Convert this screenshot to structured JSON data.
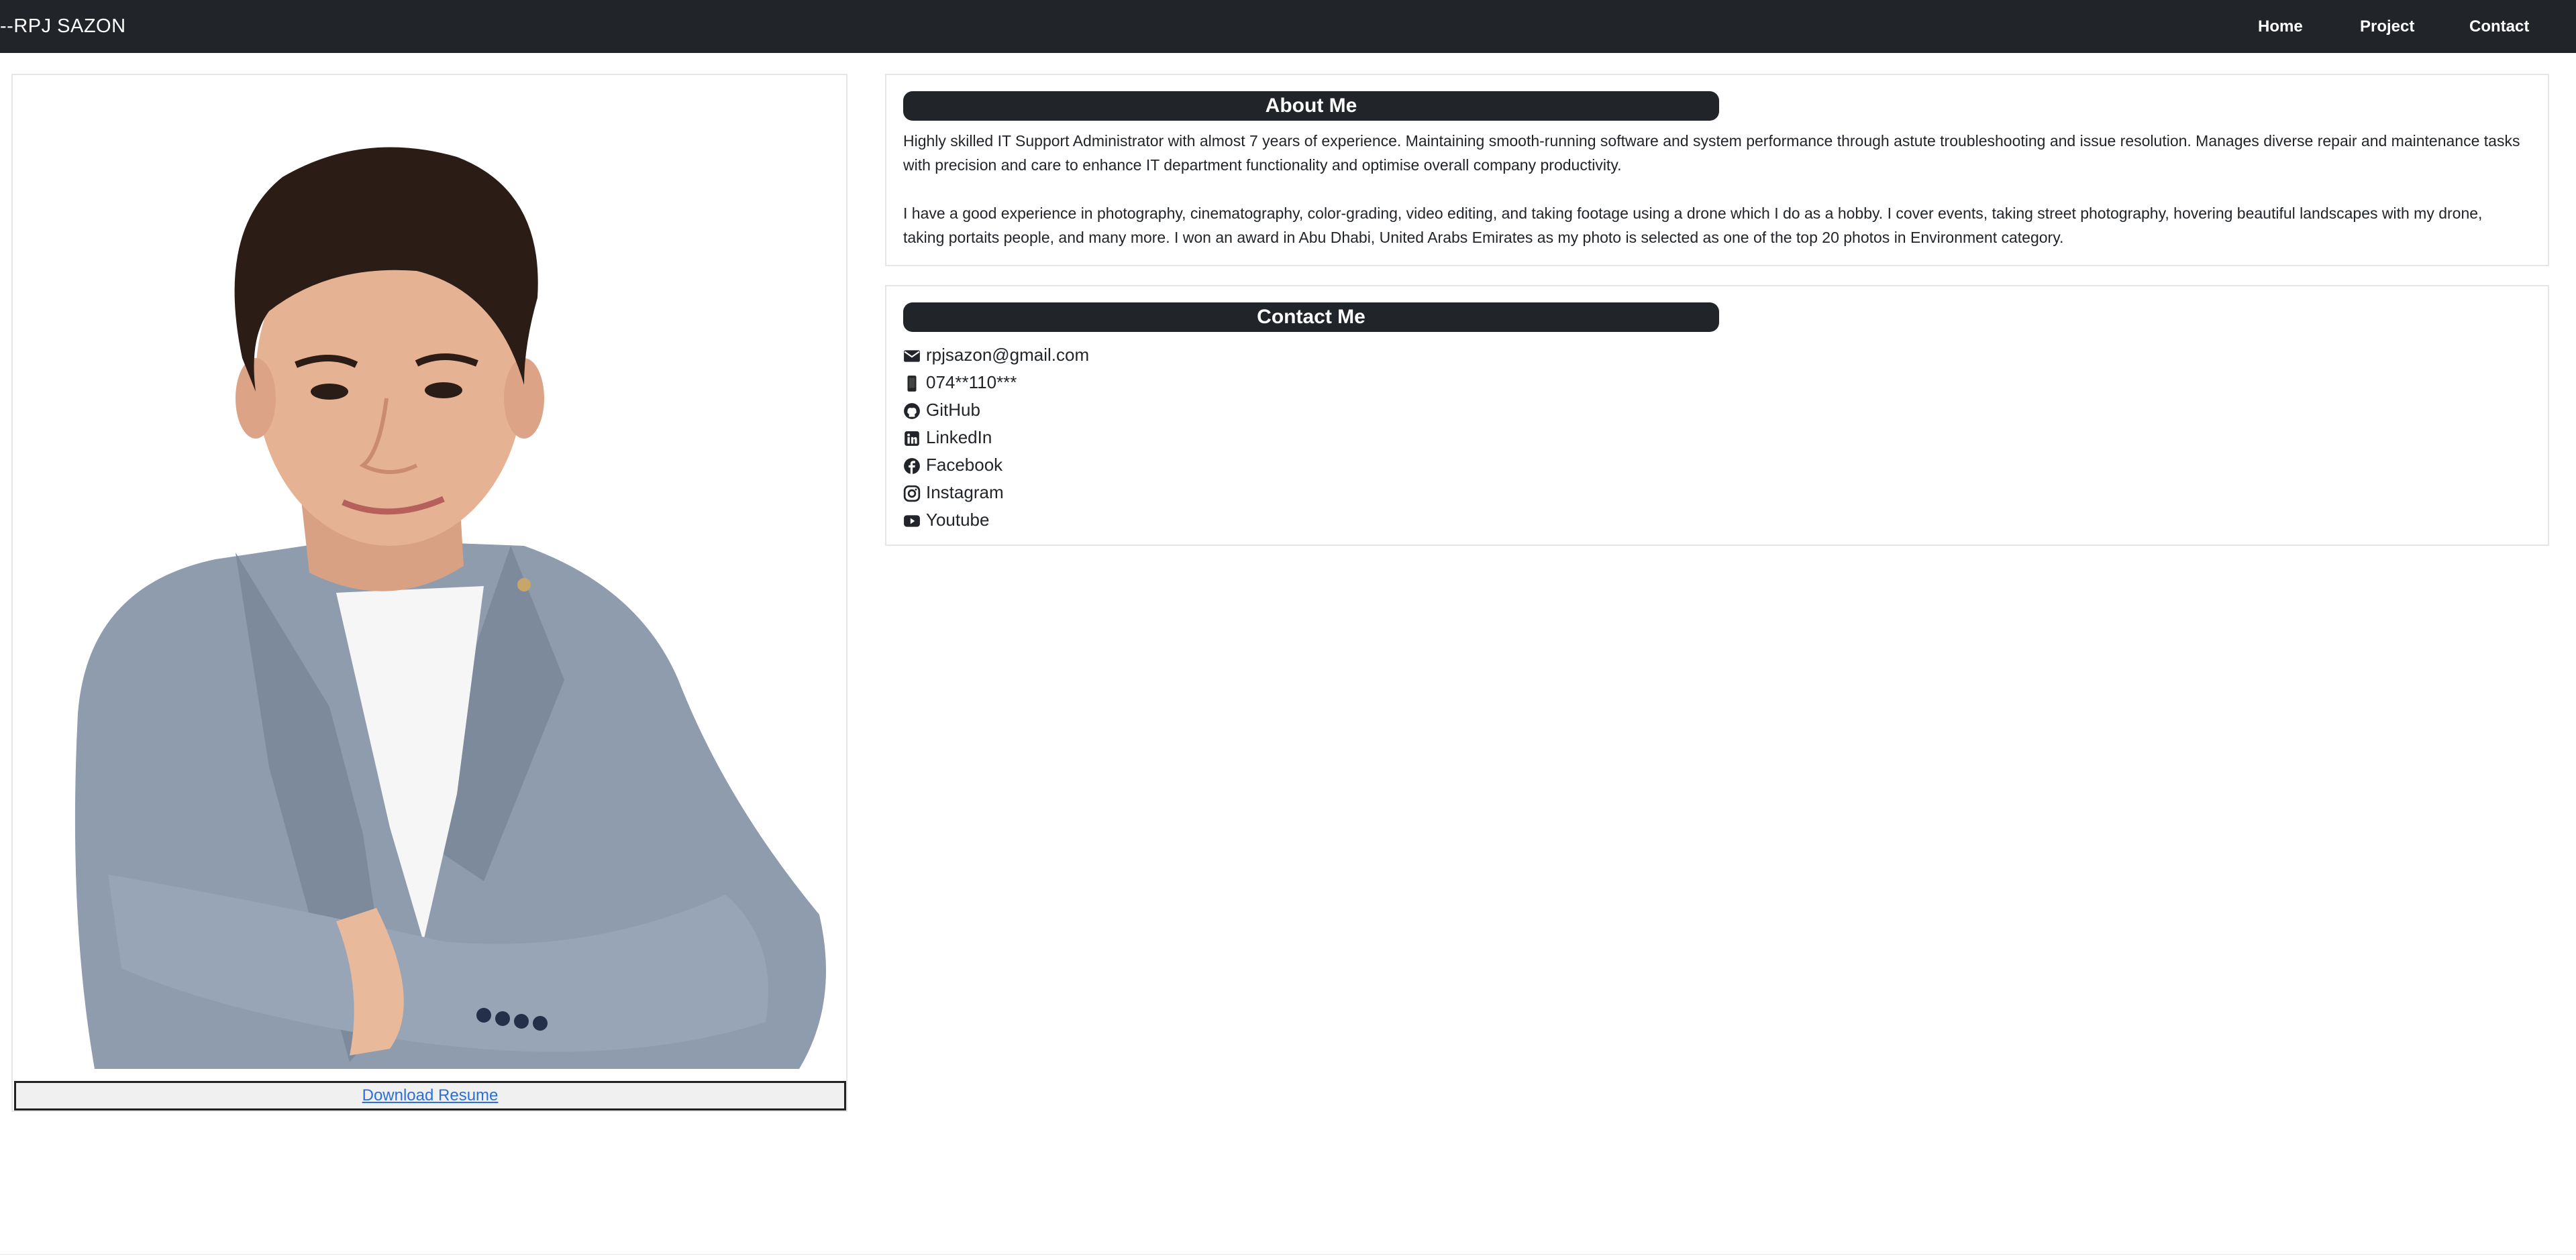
{
  "navbar": {
    "brand": "--RPJ SAZON",
    "links": [
      "Home",
      "Project",
      "Contact"
    ]
  },
  "profile": {
    "resume_label": "Download Resume"
  },
  "about": {
    "title": "About Me",
    "paragraphs": [
      "Highly skilled IT Support Administrator with almost 7 years of experience. Maintaining smooth-running software and system performance through astute troubleshooting and issue resolution. Manages diverse repair and maintenance tasks with precision and care to enhance IT department functionality and optimise overall company productivity.",
      "I have a good experience in photography, cinematography, color-grading, video editing, and taking footage using a drone which I do as a hobby. I cover events, taking street photography, hovering beautiful landscapes with my drone, taking portaits people, and many more. I won an award in Abu Dhabi, United Arabs Emirates as my photo is selected as one of the top 20 photos in Environment category."
    ]
  },
  "contact": {
    "title": "Contact Me",
    "items": [
      {
        "icon": "envelope-icon",
        "label": "rpjsazon@gmail.com"
      },
      {
        "icon": "phone-icon",
        "label": "074**110***"
      },
      {
        "icon": "github-icon",
        "label": "GitHub"
      },
      {
        "icon": "linkedin-icon",
        "label": "LinkedIn"
      },
      {
        "icon": "facebook-icon",
        "label": "Facebook"
      },
      {
        "icon": "instagram-icon",
        "label": "Instagram"
      },
      {
        "icon": "youtube-icon",
        "label": "Youtube"
      }
    ]
  },
  "colors": {
    "navbar_bg": "#212529",
    "link": "#2a6fdb",
    "suit": "#8e9cae",
    "hair": "#2b1d16"
  }
}
